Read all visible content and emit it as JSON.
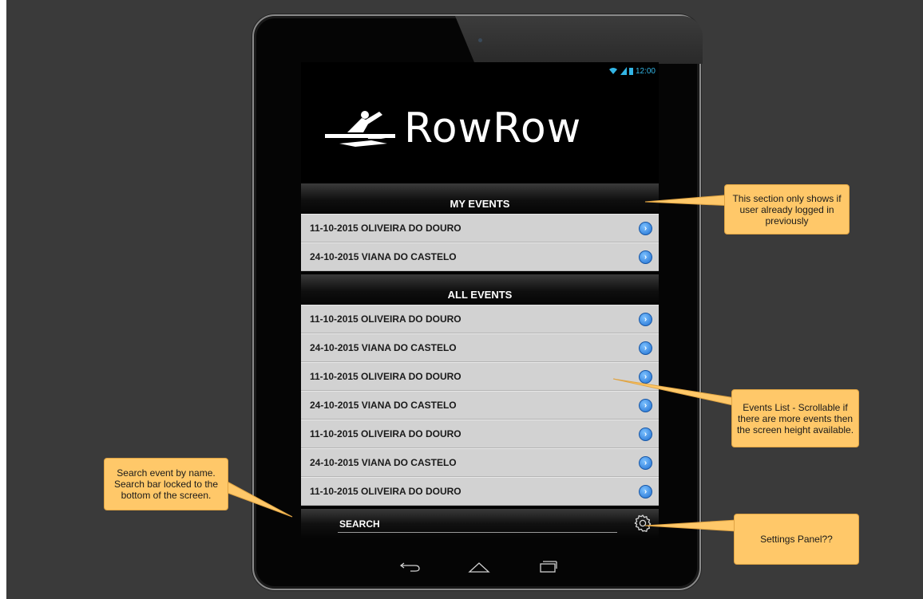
{
  "app": {
    "status_time": "12:00",
    "logo_text": "RowRow"
  },
  "my_events": {
    "header": "MY EVENTS",
    "items": [
      {
        "label": "11-10-2015 OLIVEIRA DO DOURO"
      },
      {
        "label": "24-10-2015 VIANA DO CASTELO"
      }
    ]
  },
  "all_events": {
    "header": "ALL EVENTS",
    "items": [
      {
        "label": "11-10-2015 OLIVEIRA DO DOURO"
      },
      {
        "label": "24-10-2015 VIANA DO CASTELO"
      },
      {
        "label": "11-10-2015 OLIVEIRA DO DOURO"
      },
      {
        "label": "24-10-2015 VIANA DO CASTELO"
      },
      {
        "label": "11-10-2015 OLIVEIRA DO DOURO"
      },
      {
        "label": "24-10-2015 VIANA DO CASTELO"
      },
      {
        "label": "11-10-2015 OLIVEIRA DO DOURO"
      }
    ]
  },
  "search": {
    "label": "SEARCH"
  },
  "annotations": {
    "my_events_note": "This section only shows if user already logged in previously",
    "events_list_note": "Events List - Scrollable if there are more events then the screen height available.",
    "search_note": "Search event by name. Search bar locked to the bottom of the screen.",
    "settings_note": "Settings Panel??"
  },
  "colors": {
    "callout_bg": "#ffc869",
    "row_bg": "#d2d2d2",
    "accent_blue": "#33b5e5",
    "background": "#3a3a3a"
  },
  "icons": {
    "row_arrow": "chevron-right-circle-icon",
    "settings": "gear-icon",
    "nav_back": "back-icon",
    "nav_home": "home-icon",
    "nav_recents": "recents-icon"
  }
}
